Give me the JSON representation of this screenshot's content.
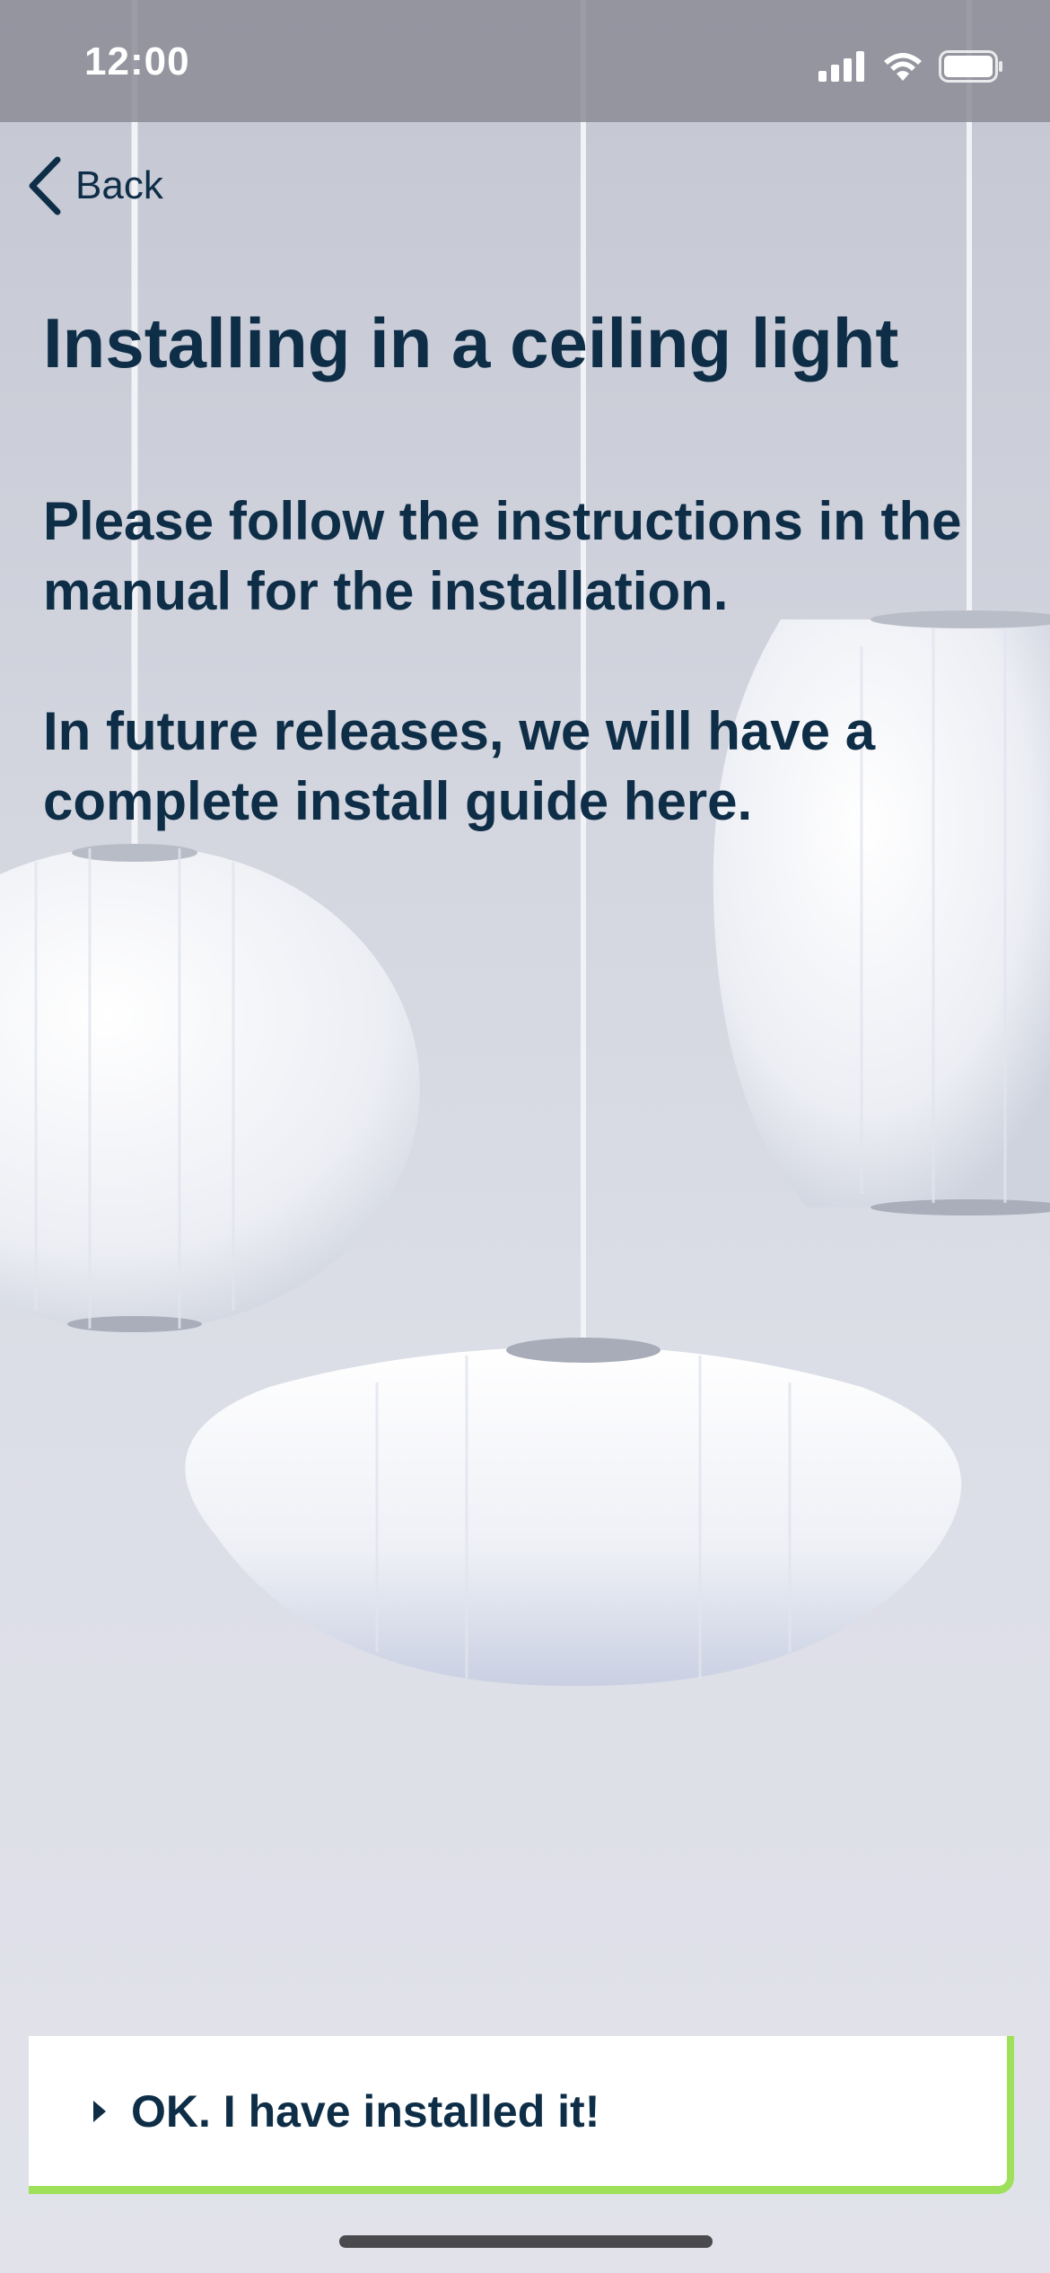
{
  "status_bar": {
    "time": "12:00",
    "icons": [
      "cellular-signal-icon",
      "wifi-icon",
      "battery-icon"
    ]
  },
  "nav": {
    "back_label": "Back",
    "back_icon": "chevron-left-icon"
  },
  "content": {
    "title": "Installing in a ceiling light",
    "paragraph_1": "Please follow the instructions in the manual for the installation.",
    "paragraph_2": "In future releases, we will have a complete install guide here."
  },
  "action": {
    "confirm_label": "OK. I have installed it!",
    "confirm_icon": "caret-right-icon"
  },
  "colors": {
    "text_primary": "#0e2e47",
    "accent_green": "#9fe05a",
    "button_bg": "#ffffff",
    "status_bar_bg": "#8c8c96"
  }
}
